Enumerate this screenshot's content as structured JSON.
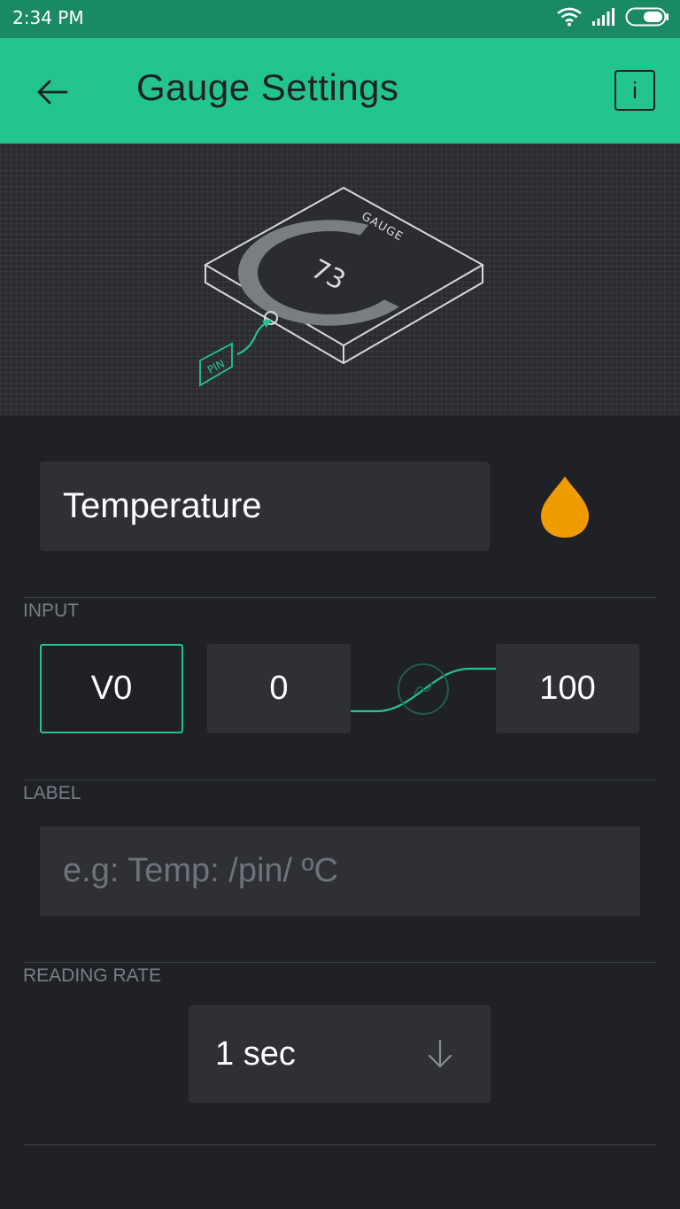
{
  "status_bar": {
    "time": "2:34 PM"
  },
  "header": {
    "title": "Gauge Settings"
  },
  "preview": {
    "gauge_caption": "GAUGE",
    "gauge_value": "73",
    "pin_caption": "PIN"
  },
  "widget": {
    "name": "Temperature",
    "color": "#f09c00"
  },
  "input": {
    "section_label": "INPUT",
    "pin": "V0",
    "min": "0",
    "max": "100"
  },
  "label": {
    "section_label": "LABEL",
    "placeholder": "e.g: Temp: /pin/ ºC",
    "value": ""
  },
  "reading_rate": {
    "section_label": "READING RATE",
    "value": "1 sec"
  },
  "colors": {
    "accent": "#23c48e",
    "status_bar": "#1a8a63",
    "background": "#1f2126",
    "field": "#2e3035"
  }
}
